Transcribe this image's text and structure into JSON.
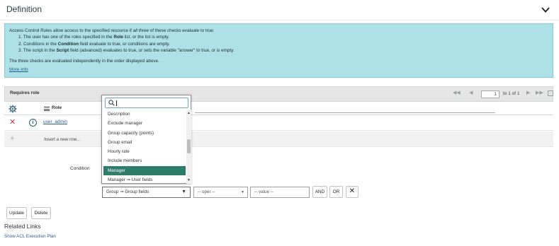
{
  "header": {
    "title": "Definition",
    "collapse_icon": "chevron-down-icon"
  },
  "info": {
    "intro_pre": "Access Control Rules allow access to the specified resource if ",
    "intro_em": "all three",
    "intro_post": " of these checks evaluate to true:",
    "items": [
      {
        "pre": "1. The user has one of the roles specified in the ",
        "bold": "Role",
        "post": " list, or the list is empty."
      },
      {
        "pre": "2. Conditions in the ",
        "bold": "Condition",
        "post": " field evaluate to true, or conditions are empty."
      },
      {
        "pre": "3. The script in the ",
        "bold": "Script",
        "post": " field (advanced) evaluates to true, or sets the variable \"answer\" to true, or is empty."
      }
    ],
    "note": "The three checks are evaluated independently in the order displayed above.",
    "more_info": "More Info"
  },
  "requires_role": {
    "label": "Requires role",
    "pager": {
      "page": "1",
      "of_text": "to 1 of 1"
    },
    "column_role": "Role",
    "rows": [
      {
        "value": "user_admin"
      }
    ],
    "insert_text": "Insert a new row..."
  },
  "condition": {
    "label": "Condition",
    "field_value": "Group ⇒ Group fields",
    "oper_placeholder": "-- oper --",
    "value_placeholder": "-- value --",
    "and_label": "AND",
    "or_label": "OR"
  },
  "dropdown": {
    "search_value": "",
    "items": [
      "Description",
      "Exclude manager",
      "Group capacity (points)",
      "Group email",
      "Hourly rate",
      "Include members",
      "Manager",
      "Manager ⇒ User fields"
    ],
    "selected_index": 6
  },
  "buttons": {
    "update": "Update",
    "delete": "Delete"
  },
  "related": {
    "title": "Related Links",
    "links": [
      "Show ACL Execution Plan"
    ]
  },
  "colors": {
    "info_bg": "#aee0e8",
    "selected_item": "#2d7c6c",
    "link": "#2a5a86",
    "delete_x": "#c83c3c"
  }
}
